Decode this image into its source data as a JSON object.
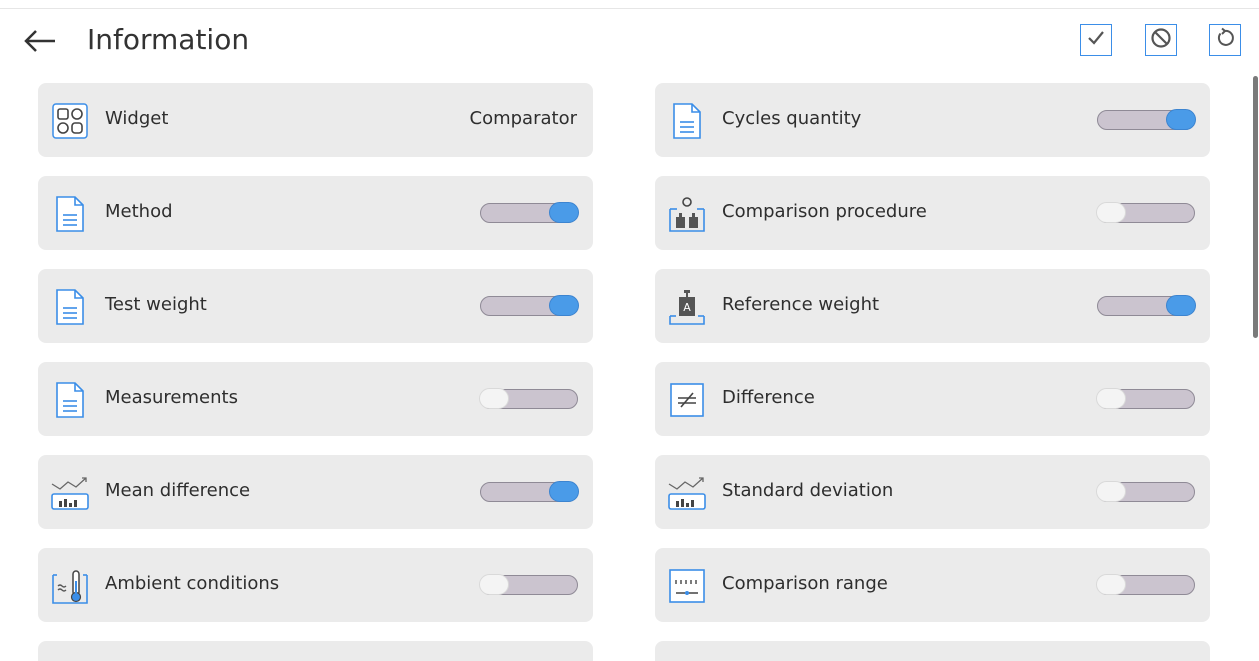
{
  "header": {
    "title": "Information"
  },
  "colors": {
    "accent": "#3b8ee8",
    "toggle_on": "#4a9be8",
    "card_bg": "#ebebeb"
  },
  "items": [
    {
      "label": "Widget",
      "value": "Comparator",
      "icon": "widget-icon",
      "type": "value"
    },
    {
      "label": "Cycles quantity",
      "icon": "document-icon",
      "type": "toggle",
      "on": true
    },
    {
      "label": "Method",
      "icon": "document-icon",
      "type": "toggle",
      "on": true
    },
    {
      "label": "Comparison procedure",
      "icon": "weights-cycle-icon",
      "type": "toggle",
      "on": false
    },
    {
      "label": "Test weight",
      "icon": "document-icon",
      "type": "toggle",
      "on": true
    },
    {
      "label": "Reference weight",
      "icon": "reference-weight-icon",
      "type": "toggle",
      "on": true
    },
    {
      "label": "Measurements",
      "icon": "document-icon",
      "type": "toggle",
      "on": false
    },
    {
      "label": "Difference",
      "icon": "difference-icon",
      "type": "toggle",
      "on": false
    },
    {
      "label": "Mean difference",
      "icon": "chart-icon",
      "type": "toggle",
      "on": true
    },
    {
      "label": "Standard deviation",
      "icon": "chart-icon",
      "type": "toggle",
      "on": false
    },
    {
      "label": "Ambient conditions",
      "icon": "thermometer-icon",
      "type": "toggle",
      "on": false
    },
    {
      "label": "Comparison range",
      "icon": "scale-range-icon",
      "type": "toggle",
      "on": false
    }
  ]
}
